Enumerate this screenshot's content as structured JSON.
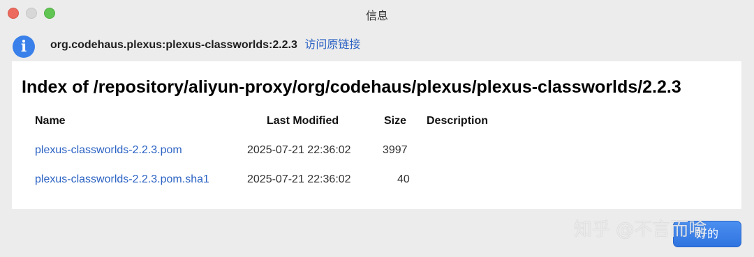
{
  "window": {
    "title": "信息"
  },
  "header": {
    "icon": "info-icon",
    "icon_glyph": "i",
    "artifact": "org.codehaus.plexus:plexus-classworlds:2.2.3",
    "visit_link": "访问原链接"
  },
  "listing": {
    "title": "Index of /repository/aliyun-proxy/org/codehaus/plexus/plexus-classworlds/2.2.3",
    "columns": {
      "name": "Name",
      "last_modified": "Last Modified",
      "size": "Size",
      "description": "Description"
    },
    "rows": [
      {
        "name": "plexus-classworlds-2.2.3.pom",
        "last_modified": "2025-07-21 22:36:02",
        "size": "3997",
        "description": ""
      },
      {
        "name": "plexus-classworlds-2.2.3.pom.sha1",
        "last_modified": "2025-07-21 22:36:02",
        "size": "40",
        "description": ""
      }
    ]
  },
  "footer": {
    "ok_label": "好的",
    "watermark": "知乎 @不言而喻"
  },
  "colors": {
    "accent": "#3a80ea",
    "link": "#2b62c3",
    "close": "#ed6a5e",
    "minimize": "#d7d7d7",
    "maximize": "#61c554"
  }
}
